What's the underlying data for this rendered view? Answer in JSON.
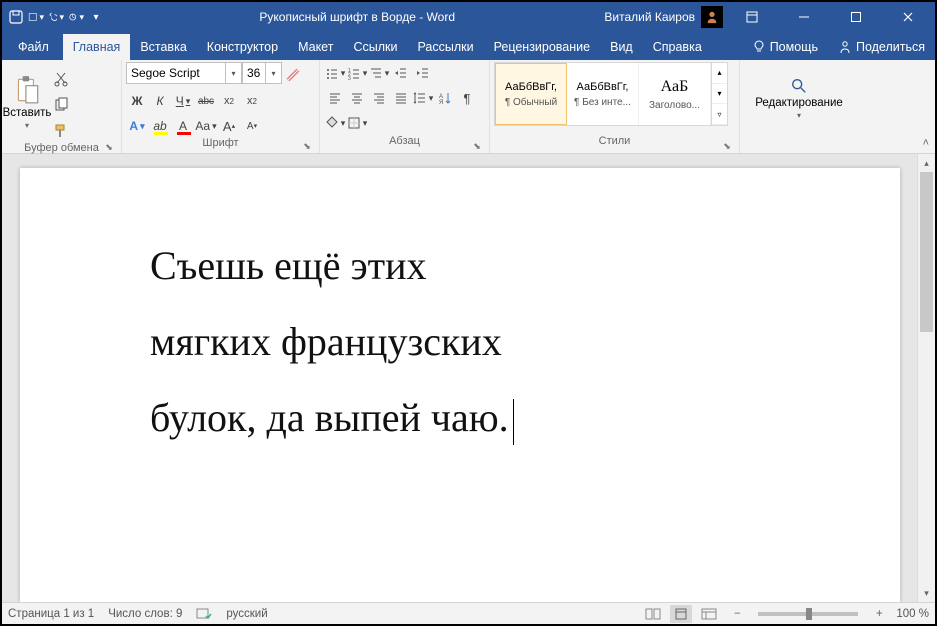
{
  "titlebar": {
    "doc_title": "Рукописный шрифт в Ворде  -  Word",
    "user_name": "Виталий Каиров"
  },
  "tabs": {
    "file": "Файл",
    "home": "Главная",
    "insert": "Вставка",
    "design": "Конструктор",
    "layout": "Макет",
    "references": "Ссылки",
    "mailings": "Рассылки",
    "review": "Рецензирование",
    "view": "Вид",
    "help": "Справка",
    "tellme": "Помощь",
    "share": "Поделиться"
  },
  "ribbon": {
    "clipboard": {
      "paste": "Вставить",
      "label": "Буфер обмена"
    },
    "font": {
      "font_name": "Segoe Script",
      "font_size": "36",
      "label": "Шрифт",
      "bold": "Ж",
      "italic": "К",
      "underline": "Ч",
      "strike": "abc",
      "text_effects": "A",
      "highlight": "A",
      "font_color": "A",
      "change_case": "Aa",
      "grow": "A",
      "shrink": "A",
      "sub": "x₂",
      "sup": "x²",
      "clear": "A"
    },
    "paragraph": {
      "label": "Абзац"
    },
    "styles": {
      "label": "Стили",
      "sample": "АаБбВвГг,",
      "sample_big": "АаБ",
      "normal": "¶ Обычный",
      "no_spacing": "¶ Без инте...",
      "heading1": "Заголово..."
    },
    "editing": {
      "label": "Редактирование"
    }
  },
  "document": {
    "line1": "Съешь ещё этих",
    "line2": "мягких французских",
    "line3": "булок, да выпей чаю."
  },
  "statusbar": {
    "page": "Страница 1 из 1",
    "words": "Число слов: 9",
    "language": "русский",
    "zoom": "100 %"
  }
}
